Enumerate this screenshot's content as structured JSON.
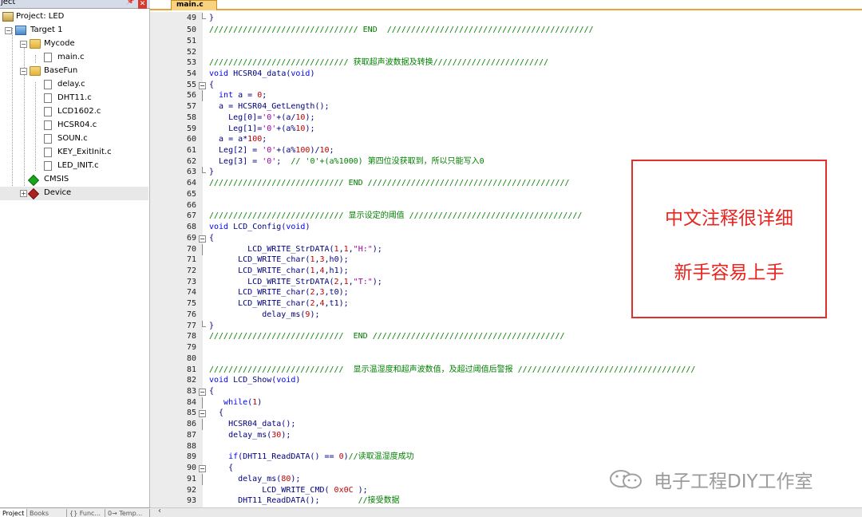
{
  "project_panel": {
    "title": "ject",
    "tree": {
      "project": "Project: LED",
      "target": "Target 1",
      "mycode": "Mycode",
      "main_c": "main.c",
      "basefun": "BaseFun",
      "files": [
        "delay.c",
        "DHT11.c",
        "LCD1602.c",
        "HCSR04.c",
        "SOUN.c",
        "KEY_ExitInit.c",
        "LED_INIT.c"
      ],
      "cmsis": "CMSIS",
      "device": "Device"
    },
    "bottom_tabs": [
      "Project",
      "Books",
      "{} Func...",
      "0→ Temp..."
    ]
  },
  "editor": {
    "file_tab": "main.c",
    "line_numbers": [
      "49",
      "50",
      "51",
      "52",
      "53",
      "54",
      "55",
      "56",
      "57",
      "58",
      "59",
      "60",
      "61",
      "62",
      "63",
      "64",
      "65",
      "66",
      "67",
      "68",
      "69",
      "70",
      "71",
      "72",
      "73",
      "74",
      "75",
      "76",
      "77",
      "78",
      "79",
      "80",
      "81",
      "82",
      "83",
      "84",
      "85",
      "86",
      "87",
      "88",
      "89",
      "90",
      "91",
      "92",
      "93"
    ],
    "code": {
      "l49": "}",
      "l50": "/////////////////////////////// END  ///////////////////////////////////////////",
      "l53a": "///////////////////////////// ",
      "l53b": "获取超声波数据及转换",
      "l53c": "////////////////////////",
      "l54a": "void",
      "l54b": " HCSR04_data(",
      "l54c": "void",
      "l54d": ")",
      "l55": "{",
      "l56a": "  int",
      "l56b": " a = ",
      "l56c": "0",
      "l56d": ";",
      "l57": "  a = HCSR04_GetLength();",
      "l58a": "    Leg[0]=",
      "l58b": "'0'",
      "l58c": "+(a/",
      "l58d": "10",
      "l58e": ");",
      "l59a": "    Leg[1]=",
      "l59b": "'0'",
      "l59c": "+(a%",
      "l59d": "10",
      "l59e": ");",
      "l60a": "  a = a*",
      "l60b": "100",
      "l60c": ";",
      "l61a": "  Leg[2] = ",
      "l61b": "'0'",
      "l61c": "+(a%",
      "l61d": "100",
      "l61e": ")/",
      "l61f": "10",
      "l61g": ";",
      "l62a": "  Leg[3] = ",
      "l62b": "'0'",
      "l62c": ";  ",
      "l62d": "// '0'+(a%1000) 第四位没获取到，所以只能写入0",
      "l63": "}",
      "l64": "//////////////////////////// END //////////////////////////////////////////",
      "l67a": "//////////////////////////// ",
      "l67b": "显示设定的阈值 ",
      "l67c": "////////////////////////////////////",
      "l68a": "void",
      "l68b": " LCD_Config(",
      "l68c": "void",
      "l68d": ")",
      "l69": "{",
      "l70a": "        LCD_WRITE_StrDATA(",
      "l70b": "1",
      "l70c": ",",
      "l70d": "1",
      "l70e": ",",
      "l70f": "\"H:\"",
      "l70g": ");",
      "l71a": "      LCD_WRITE_char(",
      "l71b": "1",
      "l71c": ",",
      "l71d": "3",
      "l71e": ",h0);",
      "l72a": "      LCD_WRITE_char(",
      "l72b": "1",
      "l72c": ",",
      "l72d": "4",
      "l72e": ",h1);",
      "l73a": "        LCD_WRITE_StrDATA(",
      "l73b": "2",
      "l73c": ",",
      "l73d": "1",
      "l73e": ",",
      "l73f": "\"T:\"",
      "l73g": ");",
      "l74a": "      LCD_WRITE_char(",
      "l74b": "2",
      "l74c": ",",
      "l74d": "3",
      "l74e": ",t0);",
      "l75a": "      LCD_WRITE_char(",
      "l75b": "2",
      "l75c": ",",
      "l75d": "4",
      "l75e": ",t1);",
      "l76a": "           delay_ms(",
      "l76b": "9",
      "l76c": ");",
      "l77": "}",
      "l78": "////////////////////////////  END ////////////////////////////////////////",
      "l81a": "////////////////////////////  ",
      "l81b": "显示温湿度和超声波数值，及超过阈值后警报 ",
      "l81c": "/////////////////////////////////////",
      "l82a": "void",
      "l82b": " LCD_Show(",
      "l82c": "void",
      "l82d": ")",
      "l83": "{",
      "l84a": "   while",
      "l84b": "(",
      "l84c": "1",
      "l84d": ")",
      "l85": "  {",
      "l86": "    HCSR04_data();",
      "l87a": "    delay_ms(",
      "l87b": "30",
      "l87c": ");",
      "l89a": "    if",
      "l89b": "(DHT11_ReadDATA() == ",
      "l89c": "0",
      "l89d": ")",
      "l89e": "//读取温湿度成功",
      "l90": "    {",
      "l91a": "      delay_ms(",
      "l91b": "80",
      "l91c": ");",
      "l92a": "           LCD_WRITE_CMD( ",
      "l92b": "0x0C",
      "l92c": " );",
      "l93a": "      DHT11_ReadDATA();        ",
      "l93b": "//接受数据"
    }
  },
  "annotation": {
    "line1": "中文注释很详细",
    "line2": "新手容易上手",
    "color": "#e8251f"
  },
  "watermark": {
    "text": "电子工程DIY工作室",
    "icon": "wechat-icon"
  }
}
